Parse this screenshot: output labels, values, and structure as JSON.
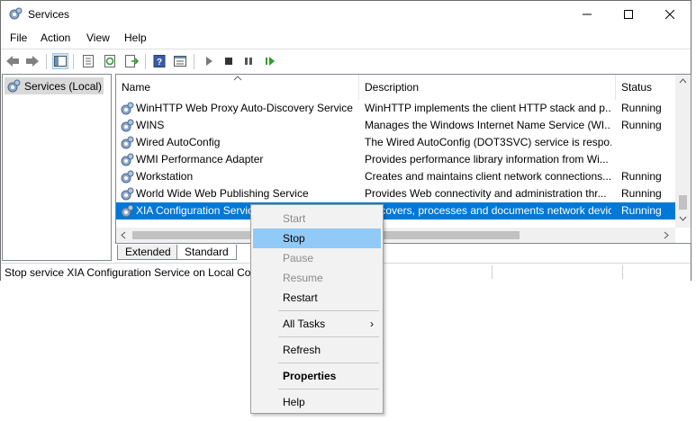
{
  "window": {
    "title": "Services"
  },
  "menubar": [
    "File",
    "Action",
    "View",
    "Help"
  ],
  "tree": {
    "root_label": "Services (Local)"
  },
  "columns": {
    "name": "Name",
    "description": "Description",
    "status": "Status"
  },
  "rows": [
    {
      "name": "WinHTTP Web Proxy Auto-Discovery Service",
      "description": "WinHTTP implements the client HTTP stack and p...",
      "status": "Running"
    },
    {
      "name": "WINS",
      "description": "Manages the Windows Internet Name Service (WI...",
      "status": "Running"
    },
    {
      "name": "Wired AutoConfig",
      "description": "The Wired AutoConfig (DOT3SVC) service is respo...",
      "status": ""
    },
    {
      "name": "WMI Performance Adapter",
      "description": "Provides performance library information from Wi...",
      "status": ""
    },
    {
      "name": "Workstation",
      "description": "Creates and maintains client network connections...",
      "status": "Running"
    },
    {
      "name": "World Wide Web Publishing Service",
      "description": "Provides Web connectivity and administration thr...",
      "status": "Running"
    },
    {
      "name": "XIA Configuration Service",
      "description": "Discovers, processes and documents network devices for the ...",
      "status": "Running"
    }
  ],
  "tabs": {
    "extended": "Extended",
    "standard": "Standard"
  },
  "statusbar": {
    "text": "Stop service XIA Configuration Service on Local Computer"
  },
  "context_menu": {
    "start": "Start",
    "stop": "Stop",
    "pause": "Pause",
    "resume": "Resume",
    "restart": "Restart",
    "all_tasks": "All Tasks",
    "refresh": "Refresh",
    "properties": "Properties",
    "help": "Help"
  },
  "colors": {
    "selection": "#0078d7",
    "menu_highlight": "#91c9f7"
  }
}
